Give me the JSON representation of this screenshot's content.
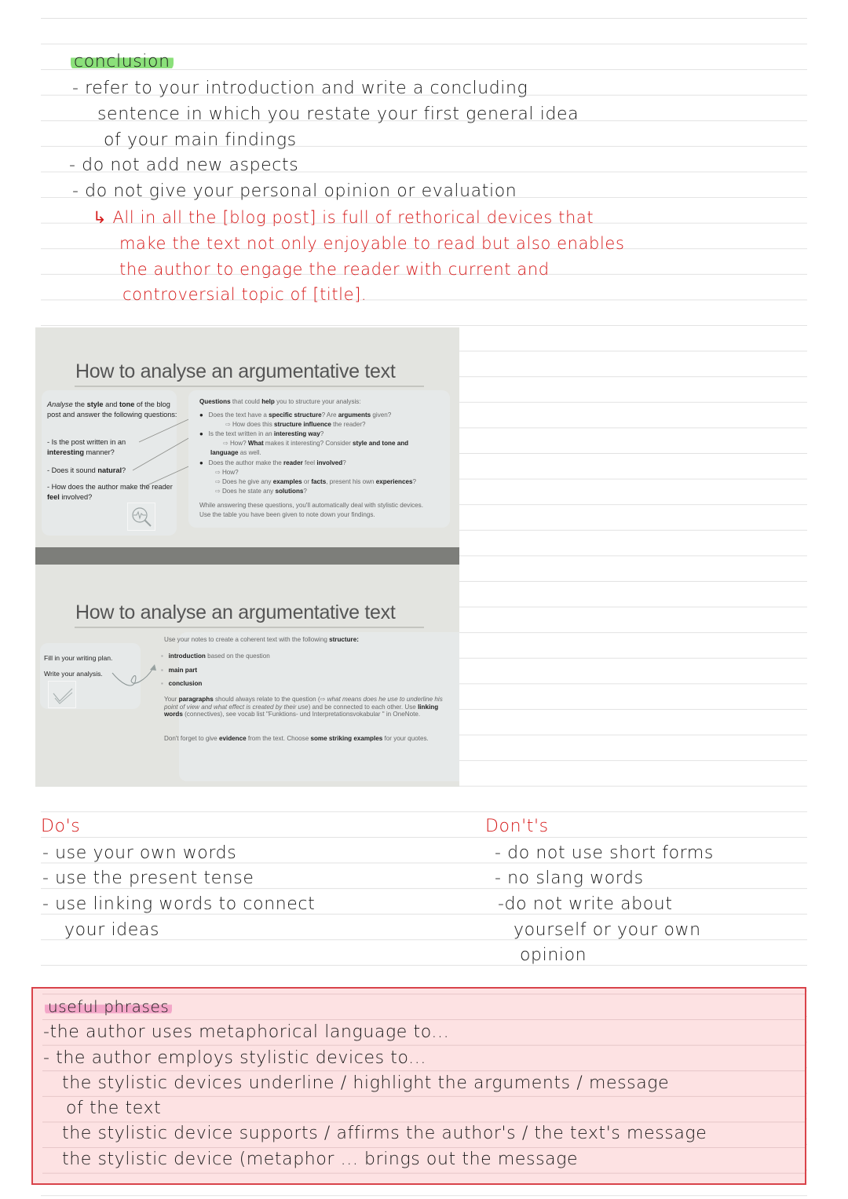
{
  "conclusion": {
    "heading": "conclusion",
    "lines": [
      "- refer  to  your  introduction  and  write  a concluding",
      "sentence  in  which  you  restate  your  first  general  idea",
      "of  your  main  findings",
      "- do  not  add  new  aspects",
      "- do  not  give  your  personal  opinion  or  evaluation"
    ],
    "example_lines": [
      "↳ All  in  all  the  [blog  post]  is  full  of  rethorical  devices   that",
      "make  the  text  not  only  enjoyable  to  read  but  also  enables",
      "the  author  to  engage  the  reader  with  current  and",
      "controversial  topic  of  [title]."
    ]
  },
  "slide1": {
    "title": "How to analyse an argumentative text",
    "left": {
      "intro_1": "Analyse",
      "intro_2": " the ",
      "intro_3": "style",
      "intro_4": " and ",
      "intro_5": "tone",
      "intro_6": " of the blog post and answer the following questions:",
      "q1_a": "- Is the post written in an ",
      "q1_b": "interesting",
      "q1_c": " manner?",
      "q2_a": "- Does it sound ",
      "q2_b": "natural",
      "q2_c": "?",
      "q3_a": "- How does the author make the reader ",
      "q3_b": "feel",
      "q3_c": " involved?"
    },
    "right": {
      "header_a": "Questions",
      "header_b": " that could ",
      "header_c": "help",
      "header_d": " you to structure your analysis:",
      "b1_a": "Does the text have a ",
      "b1_b": "specific structure",
      "b1_c": "? Are ",
      "b1_d": "arguments",
      "b1_e": " given?",
      "b1_sub_a": "How does this ",
      "b1_sub_b": "structure influence",
      "b1_sub_c": " the reader?",
      "b2_a": "Is the text written in an ",
      "b2_b": "interesting way",
      "b2_c": "?",
      "b2_sub_a": "How? ",
      "b2_sub_b": "What",
      "b2_sub_c": " makes it interesting? Consider ",
      "b2_sub_d": "style and tone and language",
      "b2_sub_e": " as well.",
      "b3_a": "Does the author make the ",
      "b3_b": "reader",
      "b3_c": " feel ",
      "b3_d": "involved",
      "b3_e": "?",
      "b3_sub1": "How?",
      "b3_sub2_a": "Does he give any ",
      "b3_sub2_b": "examples",
      "b3_sub2_c": " or ",
      "b3_sub2_d": "facts",
      "b3_sub2_e": ", present his own ",
      "b3_sub2_f": "experiences",
      "b3_sub2_g": "?",
      "b3_sub3_a": "Does he state any ",
      "b3_sub3_b": "solutions",
      "b3_sub3_c": "?",
      "footer": "While answering these questions, you'll automatically deal with stylistic devices. Use the table you have been given to note down your findings."
    },
    "icon": "magnifier-heartbeat-icon"
  },
  "slide2": {
    "title": "How to analyse an argumentative text",
    "left": {
      "line1": "Fill in your writing plan.",
      "line2": "Write your analysis."
    },
    "right": {
      "header_a": "Use your notes to create a coherent text with the following ",
      "header_b": "structure:",
      "items": [
        {
          "bold": "introduction",
          "rest": " based on the question"
        },
        {
          "bold": "main part",
          "rest": ""
        },
        {
          "bold": "conclusion",
          "rest": ""
        }
      ],
      "para1_a": "Your ",
      "para1_b": "paragraphs",
      "para1_c": " should always relate to the question (⇨ ",
      "para1_d": "what means does he use to underline his point of view and what effect is created by their use",
      "para1_e": ") and be connected to each other. Use ",
      "para1_f": "linking words",
      "para1_g": " (connectives), see vocab list \"Funktions- und Interpretationsvokabular \" in OneNote.",
      "para2_a": "Don't forget to give ",
      "para2_b": "evidence",
      "para2_c": " from the text. Choose ",
      "para2_d": "some striking examples",
      "para2_e": " for your quotes."
    },
    "icon": "pen-check-icon"
  },
  "dos": {
    "heading": "Do's",
    "lines": [
      "- use   your   own  words",
      "- use   the  present  tense",
      "- use   linking  words  to    connect",
      "your   ideas"
    ]
  },
  "donts": {
    "heading": "Don't's",
    "lines": [
      "- do  not  use   short  forms",
      "- no  slang  words",
      "-do  not   write   about",
      "yourself  or  your  own",
      "opinion"
    ]
  },
  "phrases": {
    "heading": "useful  phrases",
    "lines": [
      "-the  author  uses   metaphorical  language  to...",
      "-  the  author  employs  stylistic  devices  to...",
      "the   stylistic  devices  underline / highlight   the  arguments / message",
      "of  the  text",
      "the   stylistic  device  supports / affirms  the  author's  / the  text's  message",
      "the  stylistic  device  (metaphor ...  brings   out  the    message"
    ]
  },
  "colors": {
    "ink": "#1a1a1a",
    "red_ink": "#d61a1a",
    "green_highlight": "#8be07a",
    "pink_highlight": "#f3a6c8",
    "box_fill": "#fde2e3",
    "box_border": "#d9434a"
  }
}
